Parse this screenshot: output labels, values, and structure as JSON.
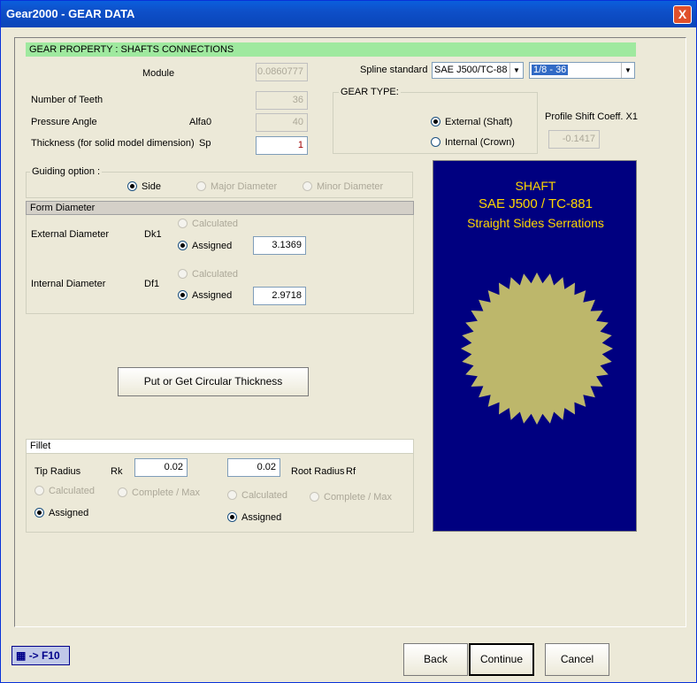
{
  "window": {
    "title": "Gear2000 - GEAR DATA",
    "close_label": "X"
  },
  "section_header": "GEAR PROPERTY : SHAFTS CONNECTIONS",
  "fields": {
    "module_label": "Module",
    "module_value": "0.0860777",
    "teeth_label": "Number of Teeth",
    "teeth_value": "36",
    "pressure_label": "Pressure Angle",
    "pressure_sym": "Alfa0",
    "pressure_value": "40",
    "thickness_label": "Thickness (for solid model dimension)",
    "thickness_sym": "Sp",
    "thickness_value": "1"
  },
  "spline": {
    "label": "Spline standard",
    "standard": "SAE J500/TC-88",
    "size": "1/8 - 36"
  },
  "gear_type": {
    "title": "GEAR TYPE:",
    "external": "External (Shaft)",
    "internal": "Internal (Crown)"
  },
  "profile_shift": {
    "label": "Profile Shift Coeff. X1",
    "value": "-0.1417"
  },
  "guiding": {
    "title": "Guiding option :",
    "side": "Side",
    "major": "Major Diameter",
    "minor": "Minor Diameter"
  },
  "form_diameter": {
    "title": "Form Diameter",
    "ext_label": "External Diameter",
    "ext_sym": "Dk1",
    "ext_calc": "Calculated",
    "ext_assigned": "Assigned",
    "ext_value": "3.1369",
    "int_label": "Internal Diameter",
    "int_sym": "Df1",
    "int_calc": "Calculated",
    "int_assigned": "Assigned",
    "int_value": "2.9718"
  },
  "circular_button": "Put or Get Circular Thickness",
  "fillet": {
    "title": "Fillet",
    "tip_label": "Tip Radius",
    "tip_sym": "Rk",
    "tip_value": "0.02",
    "root_label": "Root Radius",
    "root_sym": "Rf",
    "root_value": "0.02",
    "calculated": "Calculated",
    "complete": "Complete /  Max",
    "assigned": "Assigned"
  },
  "preview": {
    "line1": "SHAFT",
    "line2": "SAE J500  /  TC-881",
    "line3": "Straight Sides Serrations",
    "bg": "#000080",
    "gear_color": "#bdb76b"
  },
  "footer": {
    "f10": "-> F10",
    "back": "Back",
    "continue": "Continue",
    "cancel": "Cancel"
  }
}
